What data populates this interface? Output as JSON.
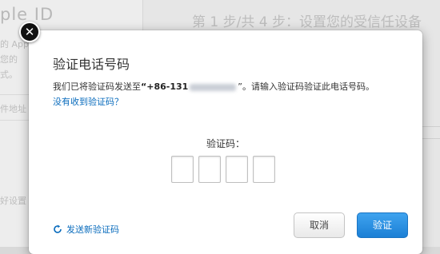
{
  "background": {
    "left_title": "ple ID",
    "left_lines": [
      "的 App",
      "您的",
      "式。",
      "件地址",
      "好设置"
    ],
    "step_title": "第 1 步/共 4 步：设置您的受信任设备"
  },
  "dialog": {
    "close_glyph": "✕",
    "title": "验证电话号码",
    "message_prefix": "我们已将验证码发送至",
    "phone_visible": "“+86-131",
    "message_suffix": "”。请输入验证码验证此电话号码。",
    "no_code_link": "没有收到验证码？",
    "code_label": "验证码：",
    "code_boxes": [
      "",
      "",
      "",
      ""
    ],
    "resend_label": "发送新验证码",
    "resend_icon": "refresh-icon",
    "cancel_label": "取消",
    "verify_label": "验证",
    "colors": {
      "link": "#0a6cbd",
      "primary_button": "#1b7fd5"
    }
  }
}
